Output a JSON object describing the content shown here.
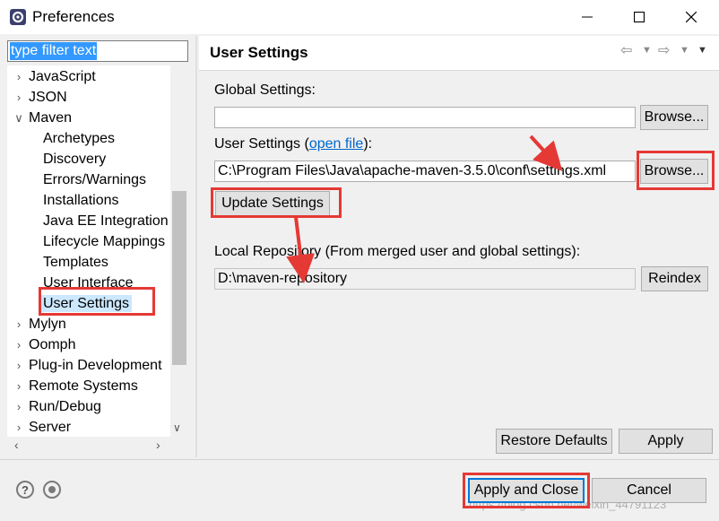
{
  "window": {
    "title": "Preferences",
    "minimize_glyph": "─",
    "maximize_glyph": "☐",
    "close_glyph": "✕"
  },
  "filter": {
    "placeholder": "type filter text",
    "value": "type filter text"
  },
  "tree": {
    "items": [
      {
        "label": "JavaScript",
        "level": 0,
        "expander": "collapsed"
      },
      {
        "label": "JSON",
        "level": 0,
        "expander": "collapsed"
      },
      {
        "label": "Maven",
        "level": 0,
        "expander": "expanded"
      },
      {
        "label": "Archetypes",
        "level": 1
      },
      {
        "label": "Discovery",
        "level": 1
      },
      {
        "label": "Errors/Warnings",
        "level": 1
      },
      {
        "label": "Installations",
        "level": 1
      },
      {
        "label": "Java EE Integration",
        "level": 1
      },
      {
        "label": "Lifecycle Mappings",
        "level": 1
      },
      {
        "label": "Templates",
        "level": 1
      },
      {
        "label": "User Interface",
        "level": 1
      },
      {
        "label": "User Settings",
        "level": 1,
        "selected": true
      },
      {
        "label": "Mylyn",
        "level": 0,
        "expander": "collapsed"
      },
      {
        "label": "Oomph",
        "level": 0,
        "expander": "collapsed"
      },
      {
        "label": "Plug-in Development",
        "level": 0,
        "expander": "collapsed"
      },
      {
        "label": "Remote Systems",
        "level": 0,
        "expander": "collapsed"
      },
      {
        "label": "Run/Debug",
        "level": 0,
        "expander": "collapsed"
      },
      {
        "label": "Server",
        "level": 0,
        "expander": "collapsed"
      }
    ]
  },
  "page": {
    "title": "User Settings",
    "global_settings_label": "Global Settings:",
    "global_settings_value": "",
    "user_settings_label_prefix": "User Settings (",
    "open_file_link": "open file",
    "user_settings_label_suffix": "):",
    "user_settings_value": "C:\\Program Files\\Java\\apache-maven-3.5.0\\conf\\settings.xml",
    "browse_label": "Browse...",
    "update_settings_label": "Update Settings",
    "local_repo_label": "Local Repository (From merged user and global settings):",
    "local_repo_value": "D:\\maven-repository",
    "reindex_label": "Reindex",
    "restore_defaults_label": "Restore Defaults",
    "apply_label": "Apply"
  },
  "footer": {
    "help_glyph": "?",
    "apply_close_label": "Apply and Close",
    "cancel_label": "Cancel"
  },
  "watermark": "https://blog.csdn.net/weixin_44791123",
  "colors": {
    "highlight": "#e53935",
    "selection": "#3399ff",
    "link": "#0066cc",
    "focus": "#0078d7"
  }
}
